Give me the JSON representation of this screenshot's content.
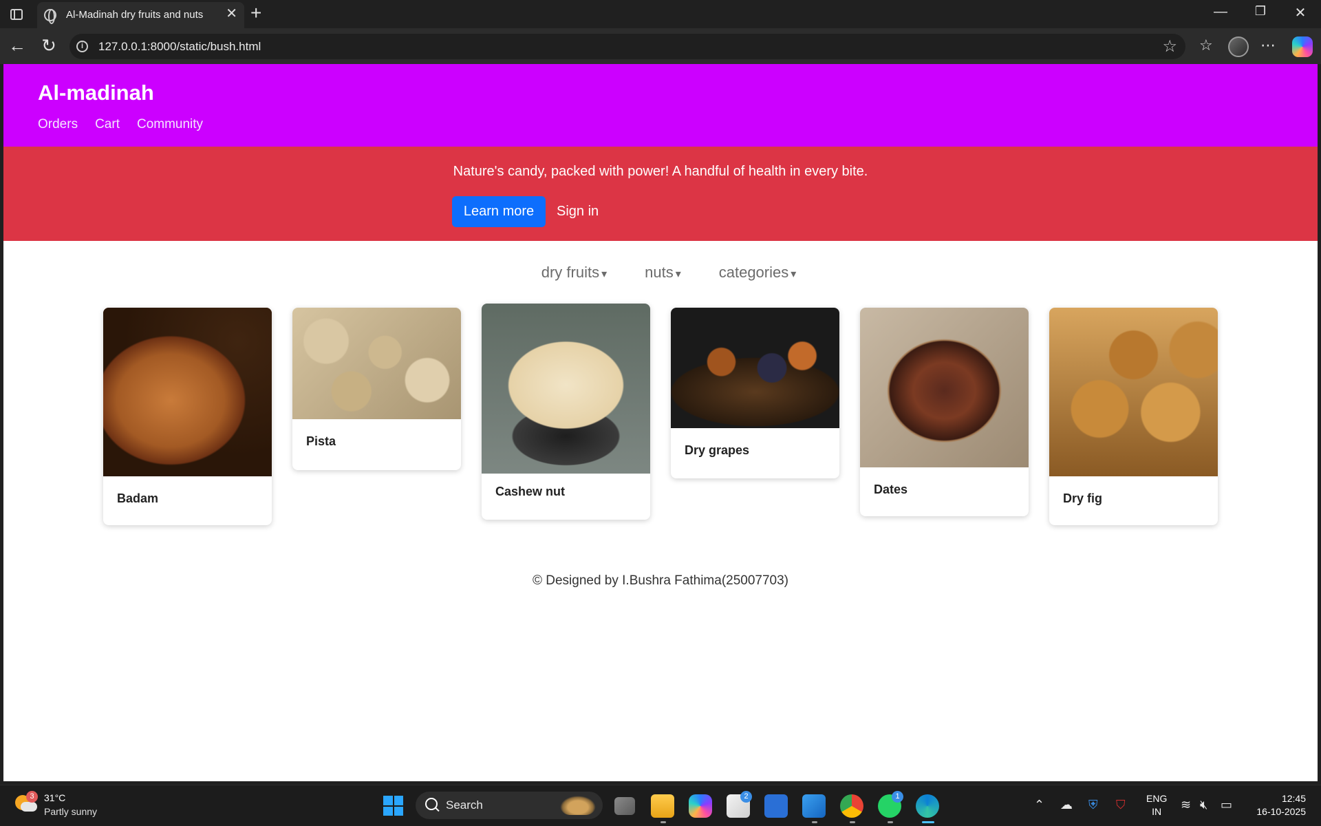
{
  "browser": {
    "tab_title": "Al-Madinah dry fruits and nuts",
    "url": "127.0.0.1:8000/static/bush.html"
  },
  "site": {
    "brand": "Al-madinah",
    "nav": [
      "Orders",
      "Cart",
      "Community"
    ],
    "hero_text": "Nature's candy, packed with power! A handful of health in every bite.",
    "learn_more": "Learn more",
    "sign_in": "Sign in",
    "filters": [
      {
        "label": "dry fruits",
        "caret": "▾"
      },
      {
        "label": "nuts",
        "caret": "▾"
      },
      {
        "label": "categories",
        "caret": "▾"
      }
    ],
    "products": [
      "Badam",
      "Pista",
      "Cashew nut",
      "Dry grapes",
      "Dates",
      "Dry fig"
    ],
    "footer": "© Designed by I.Bushra Fathima(25007703)"
  },
  "taskbar": {
    "weather_temp": "31°C",
    "weather_desc": "Partly sunny",
    "weather_badge": "3",
    "search_label": "Search",
    "store_badge": "2",
    "whatsapp_badge": "1",
    "lang_line1": "ENG",
    "lang_line2": "IN",
    "time": "12:45",
    "date": "16-10-2025"
  },
  "colors": {
    "header_bg": "#cc00ff",
    "hero_bg": "#dc3545",
    "primary_button": "#0d6efd"
  }
}
